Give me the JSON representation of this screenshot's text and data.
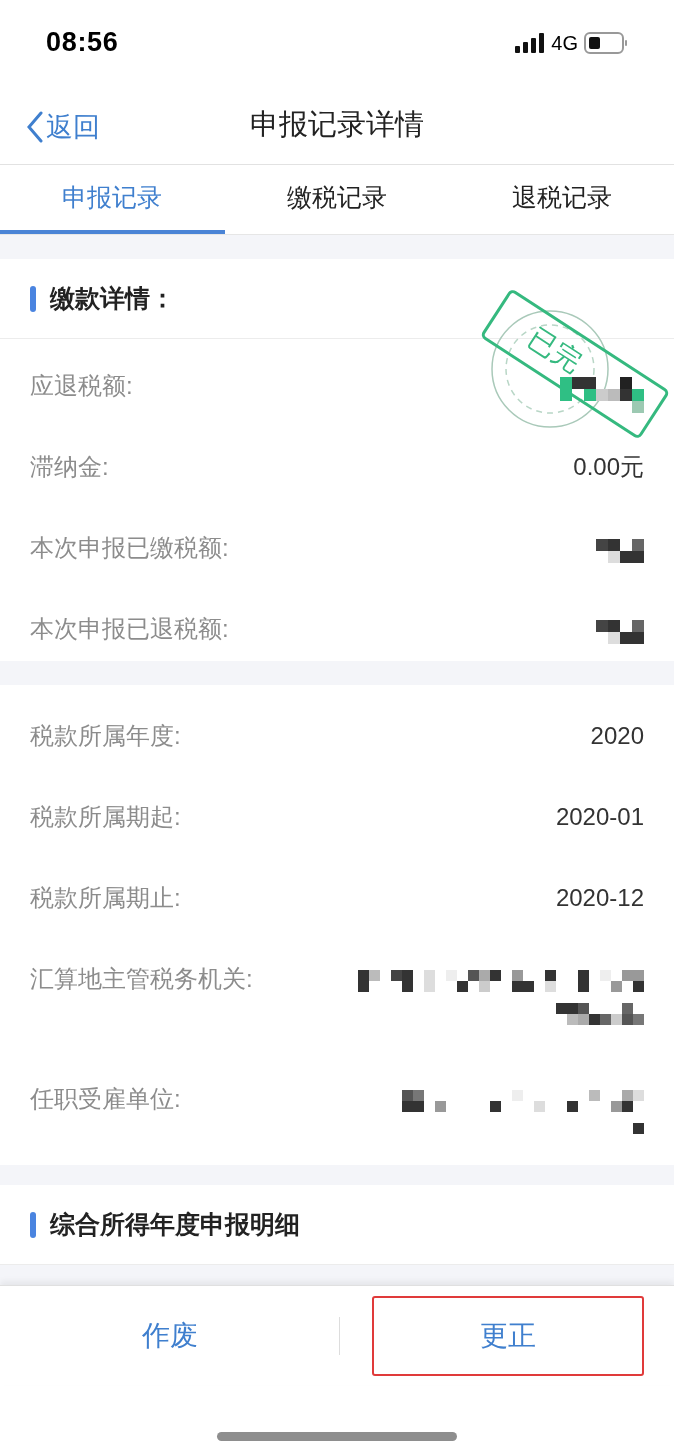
{
  "status_bar": {
    "time": "08:56",
    "network": "4G"
  },
  "nav": {
    "back": "返回",
    "title": "申报记录详情"
  },
  "tabs": [
    {
      "label": "申报记录",
      "selected": true
    },
    {
      "label": "缴税记录",
      "selected": false
    },
    {
      "label": "退税记录",
      "selected": false
    }
  ],
  "payment_section": {
    "title": "缴款详情：",
    "stamp": "已完",
    "rows": [
      {
        "label": "应退税额:",
        "kind": "redacted"
      },
      {
        "label": "滞纳金:",
        "kind": "text",
        "value": "0.00元"
      },
      {
        "label": "本次申报已缴税额:",
        "kind": "redacted"
      },
      {
        "label": "本次申报已退税额:",
        "kind": "redacted"
      }
    ]
  },
  "period_section": {
    "rows": [
      {
        "label": "税款所属年度:",
        "kind": "text",
        "value": "2020"
      },
      {
        "label": "税款所属期起:",
        "kind": "text",
        "value": "2020-01"
      },
      {
        "label": "税款所属期止:",
        "kind": "text",
        "value": "2020-12"
      },
      {
        "label": "汇算地主管税务机关:",
        "kind": "redacted"
      },
      {
        "label": "任职受雇单位:",
        "kind": "redacted"
      }
    ]
  },
  "detail_section": {
    "title": "综合所得年度申报明细"
  },
  "actions": [
    {
      "label": "作废",
      "highlighted": false
    },
    {
      "label": "更正",
      "highlighted": true
    }
  ]
}
